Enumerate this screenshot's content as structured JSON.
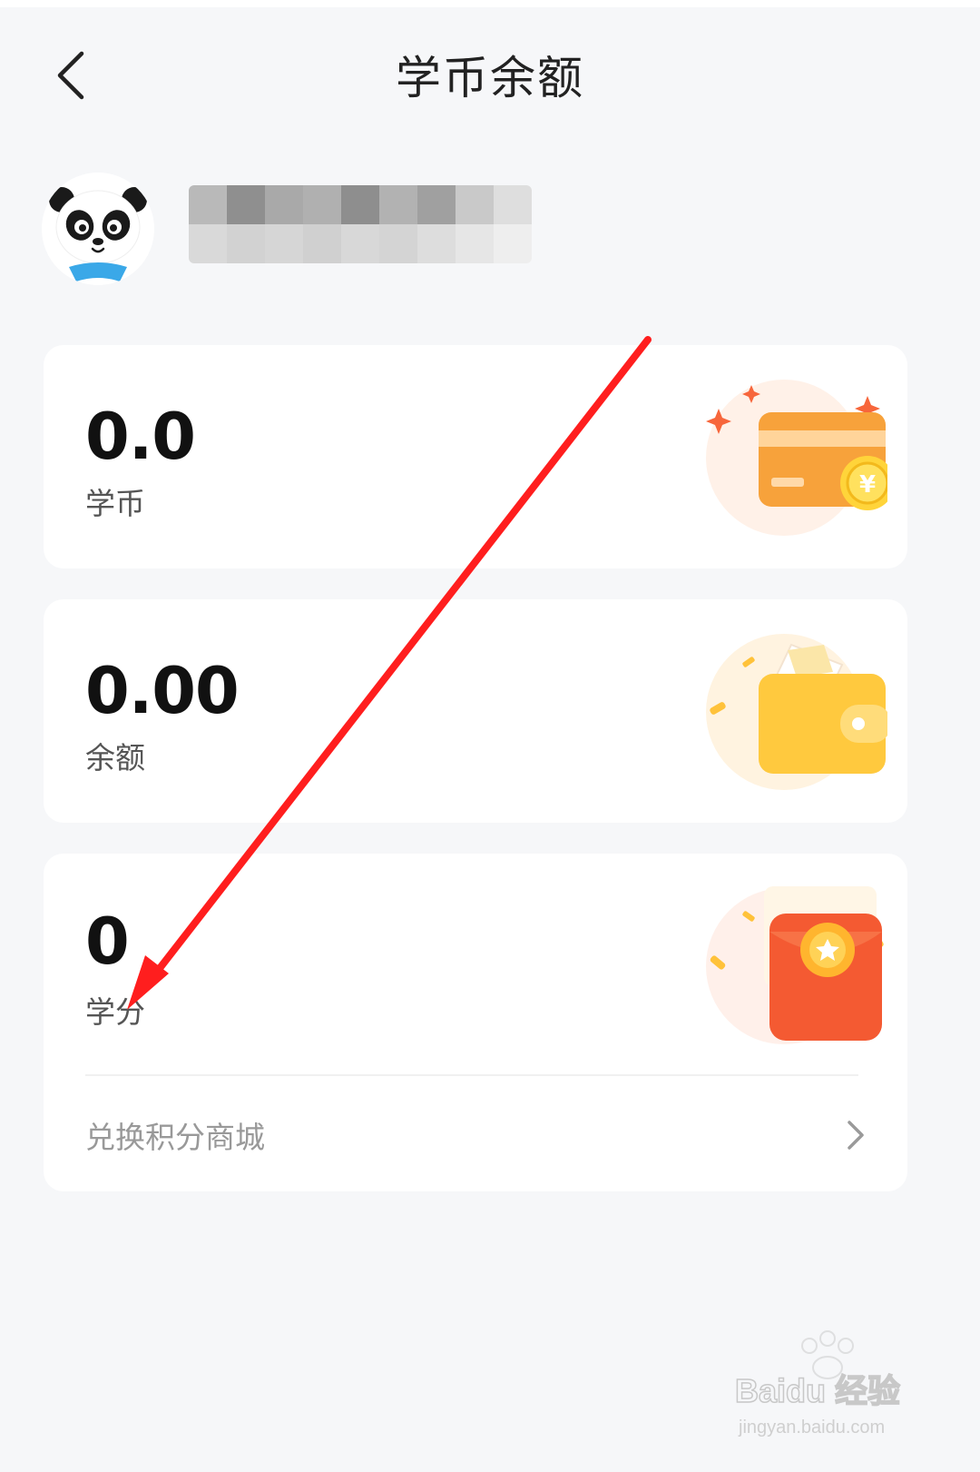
{
  "header": {
    "title": "学币余额"
  },
  "cards": {
    "coin": {
      "value": "0.0",
      "label": "学币"
    },
    "balance": {
      "value": "0.00",
      "label": "余额"
    },
    "credit": {
      "value": "0",
      "label": "学分",
      "exchange_label": "兑换积分商城"
    }
  },
  "watermark": {
    "brand": "Baidu 经验",
    "url": "jingyan.baidu.com"
  },
  "colors": {
    "background": "#f6f7f9",
    "card": "#ffffff",
    "annotation_arrow": "#ff1e1e",
    "coin_orange": "#f7a23b",
    "wallet_yellow": "#ffc93e",
    "envelope_red": "#f45a32"
  },
  "icons": {
    "back": "chevron-left-icon",
    "avatar": "panda-avatar-icon",
    "coin_card": "credit-card-coin-icon",
    "wallet": "wallet-icon",
    "red_envelope": "red-envelope-icon",
    "exchange_chevron": "chevron-right-icon"
  }
}
